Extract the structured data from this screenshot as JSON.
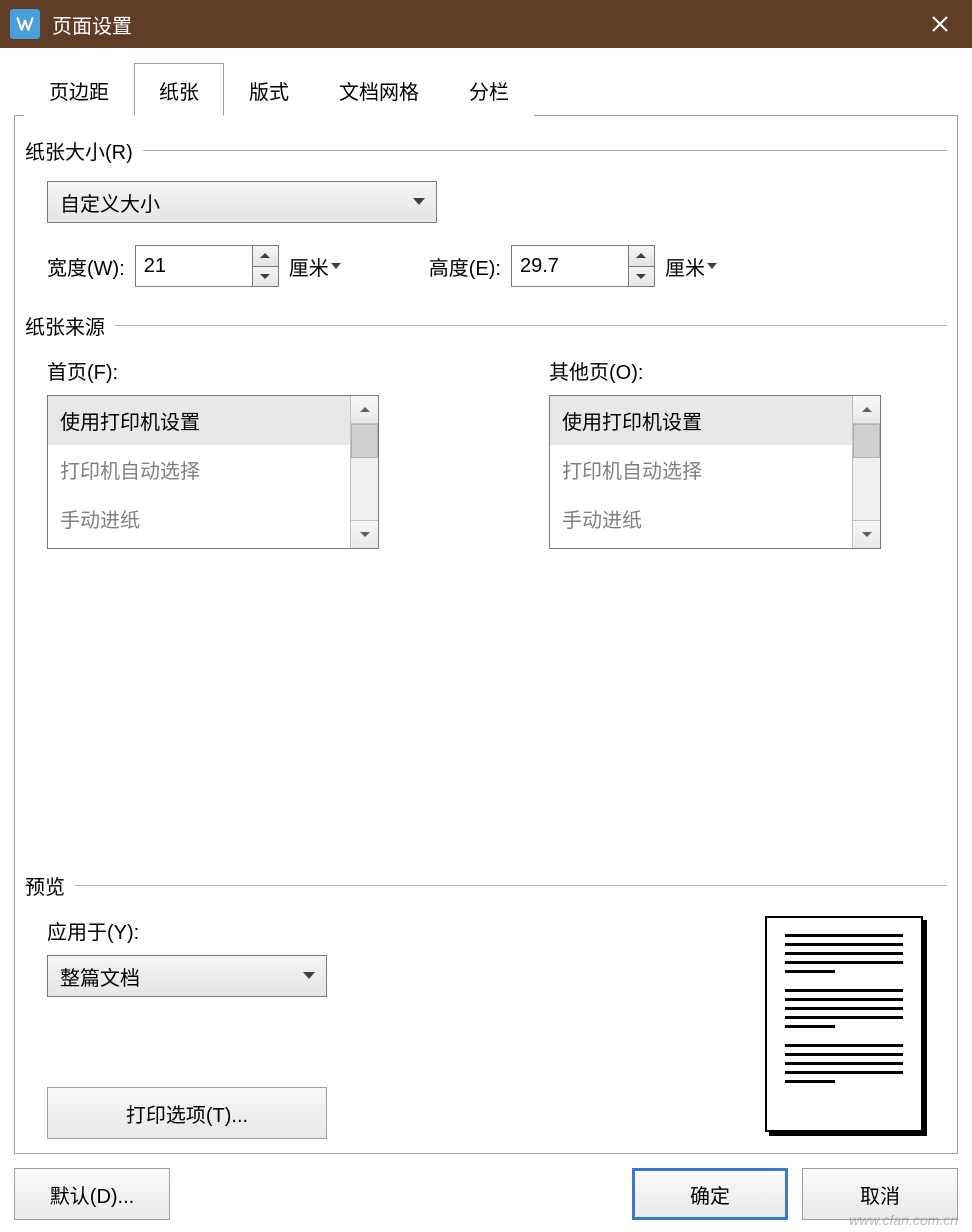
{
  "titlebar": {
    "title": "页面设置"
  },
  "tabs": {
    "margins": "页边距",
    "paper": "纸张",
    "layout": "版式",
    "grid": "文档网格",
    "columns": "分栏"
  },
  "paper_size": {
    "header": "纸张大小(R)",
    "size_selected": "自定义大小",
    "width_label": "宽度(W):",
    "width_value": "21",
    "width_unit": "厘米",
    "height_label": "高度(E):",
    "height_value": "29.7",
    "height_unit": "厘米"
  },
  "paper_source": {
    "header": "纸张来源",
    "first_page_label": "首页(F):",
    "other_pages_label": "其他页(O):",
    "options": {
      "use_printer": "使用打印机设置",
      "auto_select": "打印机自动选择",
      "manual_feed": "手动进纸"
    }
  },
  "preview": {
    "header": "预览",
    "apply_to_label": "应用于(Y):",
    "apply_to_selected": "整篇文档",
    "print_options": "打印选项(T)..."
  },
  "footer": {
    "default": "默认(D)...",
    "ok": "确定",
    "cancel": "取消"
  },
  "watermark": "www.cfan.com.cn"
}
